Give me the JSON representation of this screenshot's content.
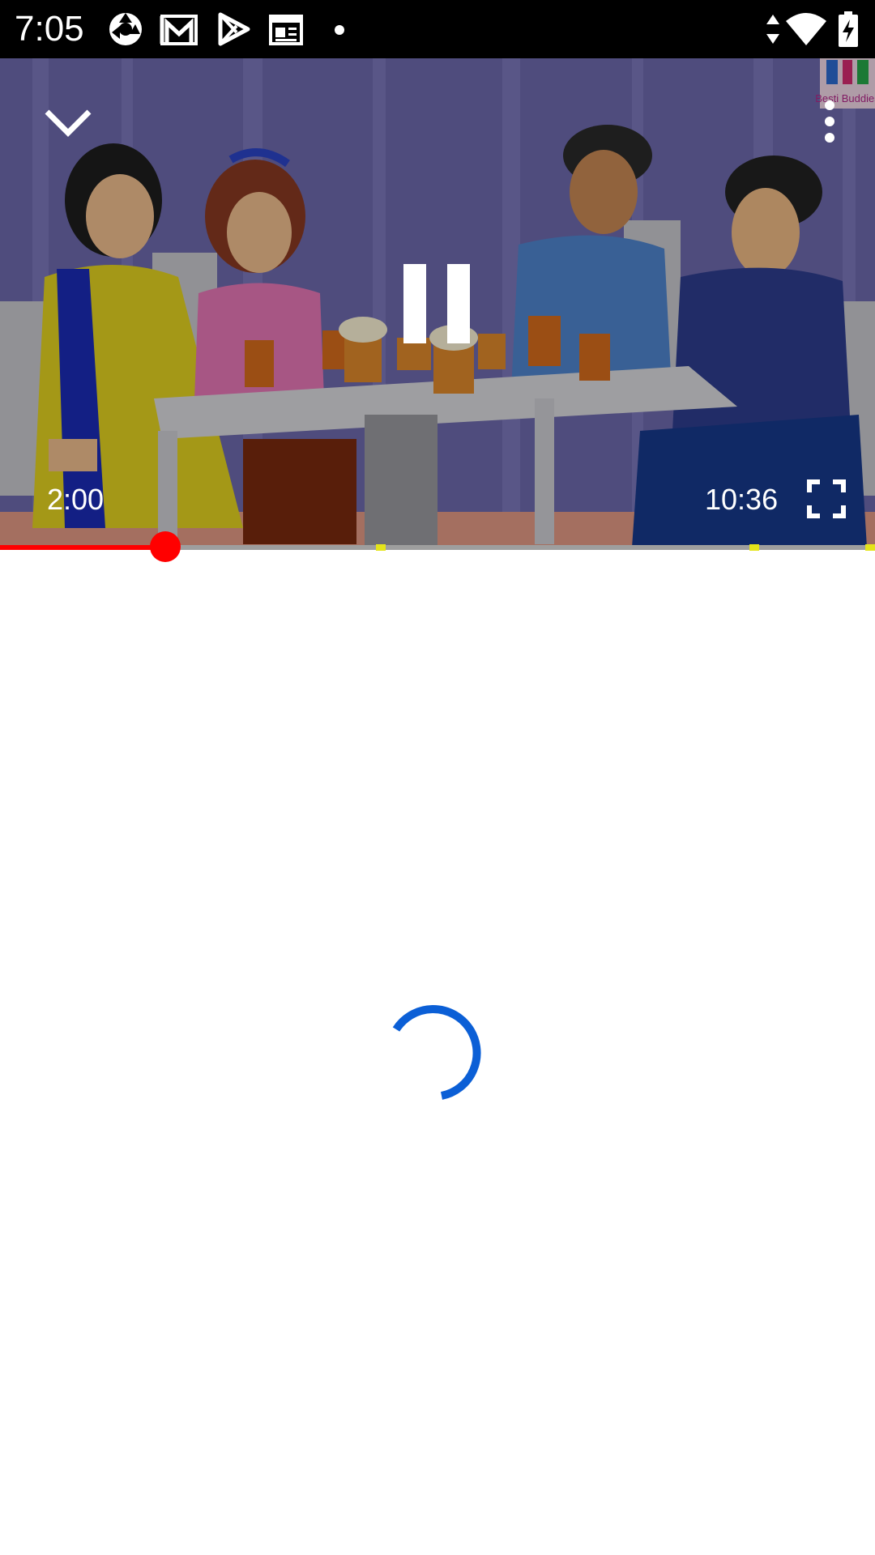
{
  "status_bar": {
    "time": "7:05",
    "icons": [
      "camera-shutter-icon",
      "gmail-icon",
      "play-store-icon",
      "news-icon",
      "notification-dot-icon",
      "data-arrows-icon",
      "wifi-icon",
      "battery-charging-icon"
    ]
  },
  "player": {
    "current_time": "2:00",
    "duration": "10:36",
    "progress": 0.189,
    "ad_markers": [
      0.435,
      0.862,
      0.995
    ],
    "channel_watermark_text": "Besti Buddies",
    "state": "playing",
    "icons": [
      "collapse-chevron-icon",
      "more-vert-icon",
      "pause-icon",
      "fullscreen-icon"
    ],
    "colors": {
      "progress": "#ff0000",
      "ad_marker": "#e4e41a",
      "track": "#9e9e9e"
    }
  },
  "content": {
    "loading": true,
    "spinner_color": "#0b5fd6"
  }
}
